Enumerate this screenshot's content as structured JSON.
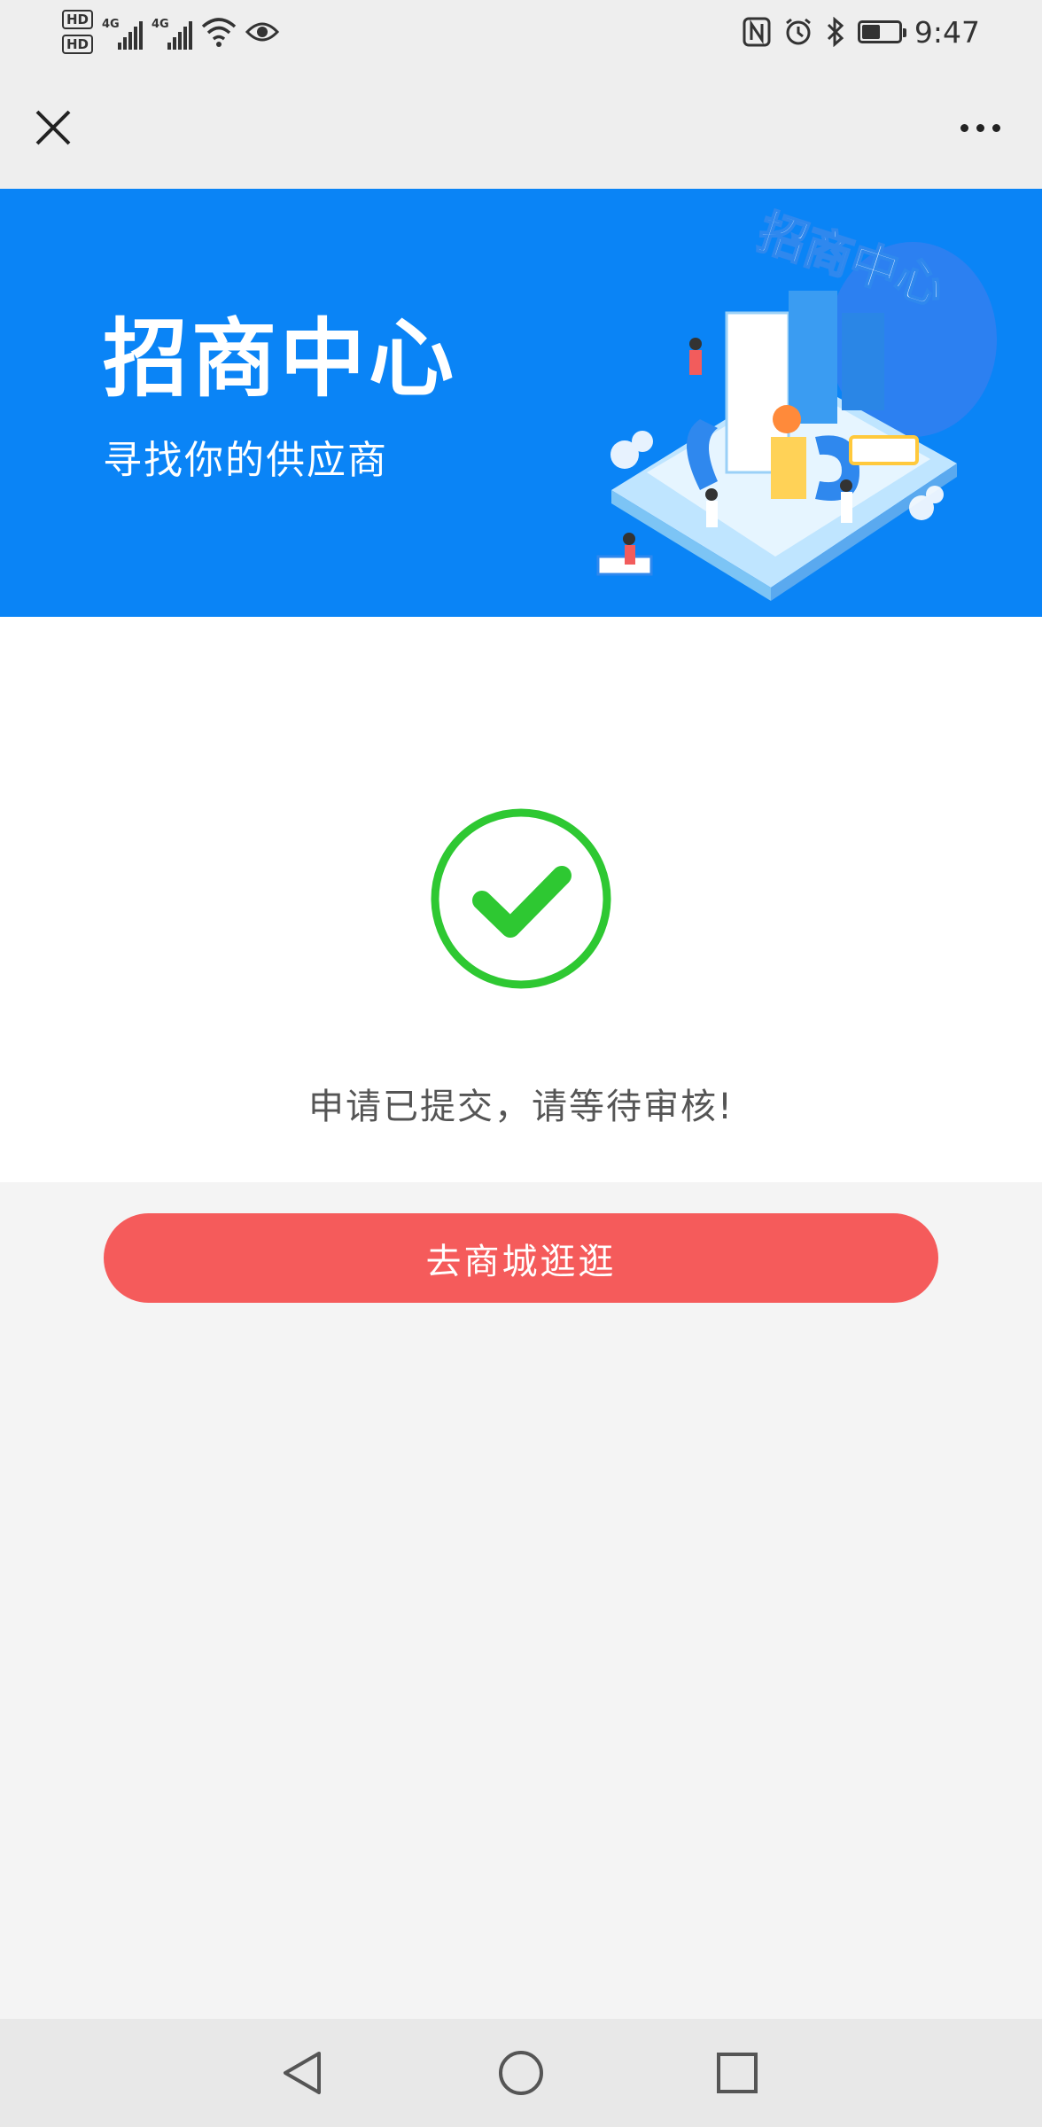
{
  "status_bar": {
    "sim1_label": "HD",
    "sim2_label": "HD",
    "network1": "4G",
    "network2": "4G",
    "time": "9:47",
    "battery_level": 0.45
  },
  "banner": {
    "title": "招商中心",
    "subtitle": "寻找你的供应商",
    "illustration_text": "招商中心",
    "background_color": "#0a84f6"
  },
  "result": {
    "icon": "check-circle-icon",
    "icon_color": "#2ec832",
    "message": "申请已提交，请等待审核!"
  },
  "actions": {
    "shop_button_label": "去商城逛逛",
    "shop_button_color": "#f55b5b"
  },
  "system_nav": {
    "back": "back-triangle-icon",
    "home": "home-circle-icon",
    "recents": "recents-square-icon"
  }
}
